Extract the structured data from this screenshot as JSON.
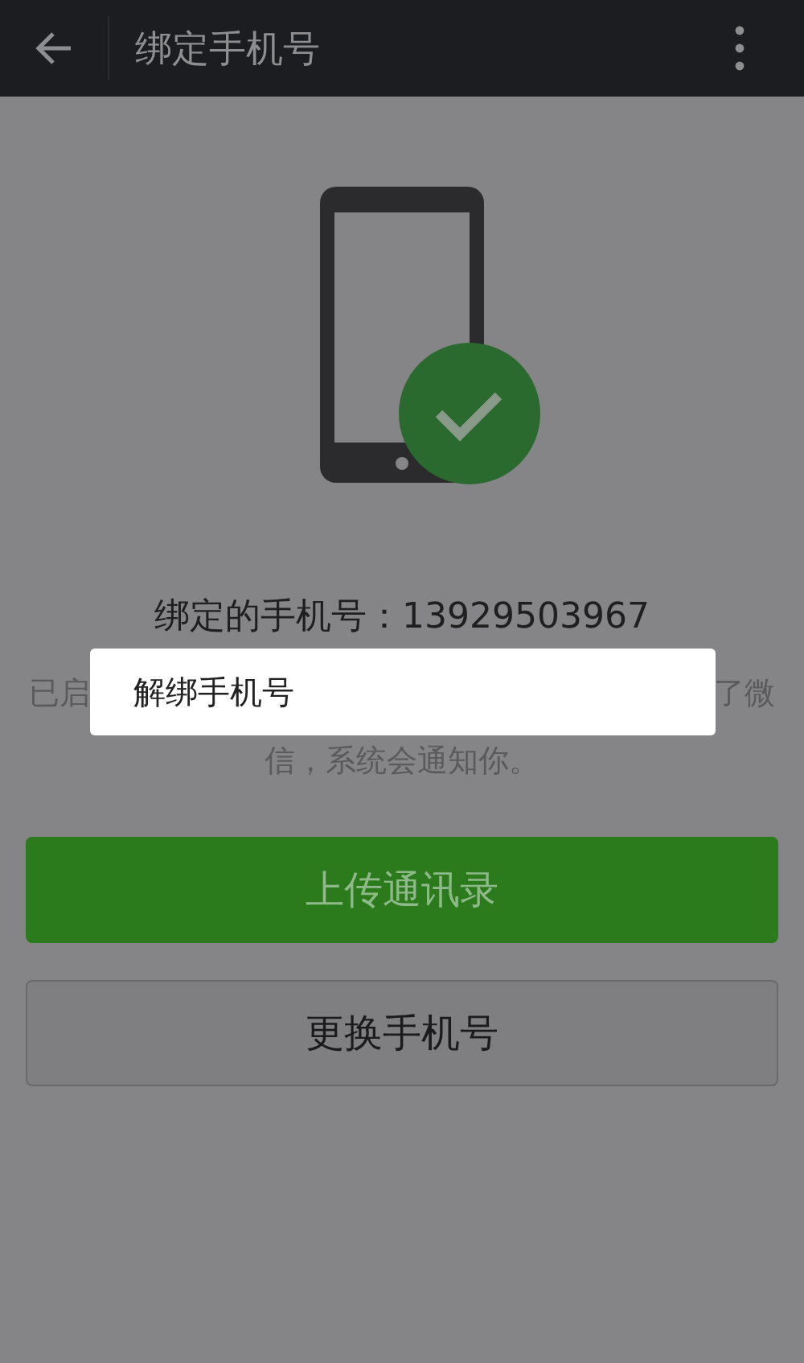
{
  "header": {
    "title": "绑定手机号"
  },
  "bound_number": "绑定的手机号：13929503967",
  "notice": {
    "line_1_left": "已启",
    "line_1_right": "了微",
    "line_2": "信，系统会通知你。"
  },
  "buttons": [
    {
      "label": "上传通讯录",
      "kind": "primary"
    },
    {
      "label": "更换手机号",
      "kind": "secondary"
    }
  ],
  "popup_menu": {
    "items": [
      "解绑手机号"
    ]
  }
}
